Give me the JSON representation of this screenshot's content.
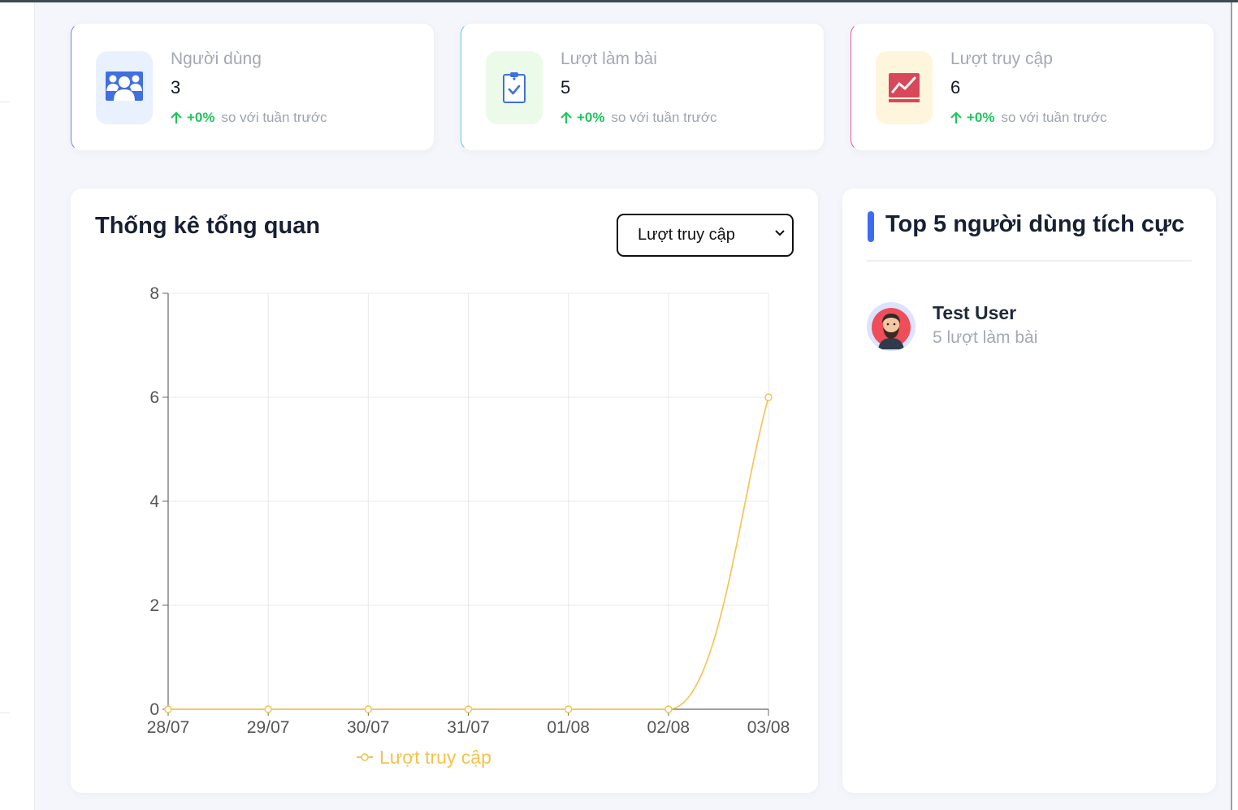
{
  "stats": [
    {
      "title": "Người dùng",
      "value": "3",
      "change": "+0%",
      "compare": "so với tuần trước",
      "icon": "users-icon",
      "accent": "#3b6cf2"
    },
    {
      "title": "Lượt làm bài",
      "value": "5",
      "change": "+0%",
      "compare": "so với tuần trước",
      "icon": "clipboard-check-icon",
      "accent": "#3b6cf2"
    },
    {
      "title": "Lượt truy cập",
      "value": "6",
      "change": "+0%",
      "compare": "so với tuần trước",
      "icon": "trend-chart-icon",
      "accent": "#d9475b"
    }
  ],
  "overview": {
    "title": "Thống kê tổng quan",
    "select": {
      "selected": "Lượt truy cập",
      "icon": "chevron-down-icon"
    }
  },
  "top5": {
    "title": "Top 5 người dùng tích cực",
    "users": [
      {
        "name": "Test User",
        "detail": "5 lượt làm bài"
      }
    ]
  },
  "colors": {
    "line": "#f5c24c",
    "positive": "#22c55e",
    "accent": "#3b6cf2"
  },
  "chart_data": {
    "type": "line",
    "categories": [
      "28/07",
      "29/07",
      "30/07",
      "31/07",
      "01/08",
      "02/08",
      "03/08"
    ],
    "series": [
      {
        "name": "Lượt truy cập",
        "values": [
          0,
          0,
          0,
          0,
          0,
          0,
          6
        ],
        "color": "#f5c24c"
      }
    ],
    "ylim": [
      0,
      8
    ],
    "yticks": [
      0,
      2,
      4,
      6,
      8
    ],
    "grid": true,
    "legend": "bottom"
  }
}
